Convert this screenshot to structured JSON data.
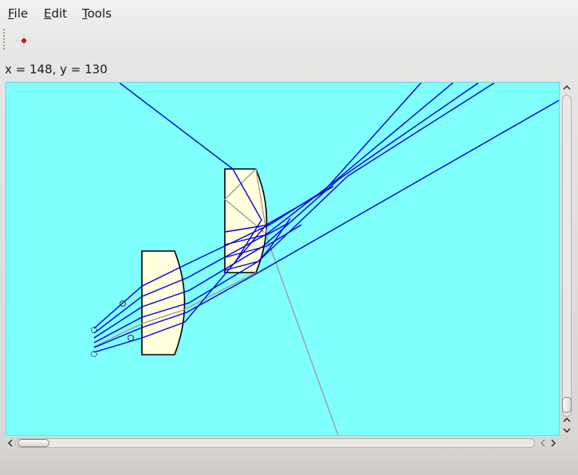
{
  "menubar": {
    "items": [
      {
        "label": "File",
        "mnemonic": "F",
        "rest": "ile"
      },
      {
        "label": "Edit",
        "mnemonic": "E",
        "rest": "dit"
      },
      {
        "label": "Tools",
        "mnemonic": "T",
        "rest": "ools"
      }
    ]
  },
  "toolbar": {
    "tools": [
      {
        "icon": "crosshair-point-icon",
        "selected": true
      }
    ]
  },
  "status": {
    "cursor_readout": "x = 148, y = 130"
  },
  "canvas": {
    "background": "#80ffff",
    "lens_fill": "#ffffdd",
    "ray_color": "#0000dd",
    "secondary_ray_color": "#999999"
  },
  "scrollbars": {
    "vertical_position": 0.98,
    "horizontal_position": 0.0
  }
}
